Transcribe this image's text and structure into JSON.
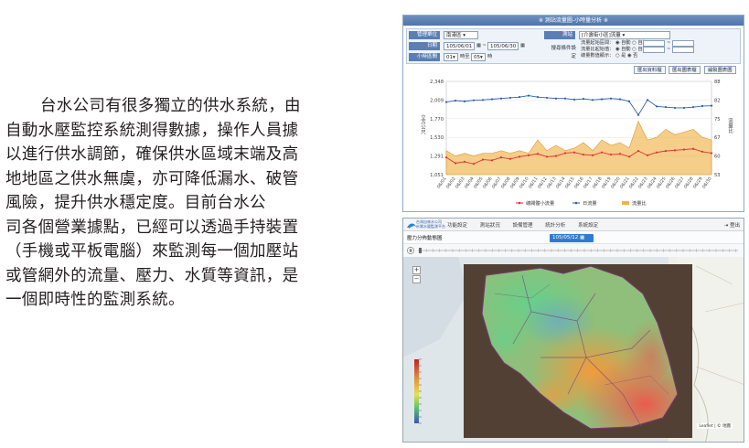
{
  "paragraph": {
    "lines": [
      "台水公司有很多獨立的供水系統，由",
      "自動水壓監控系統測得數據，操作人員據",
      "以進行供水調節，確保供水區域末端及高",
      "地地區之供水無虞，亦可降低漏水、破管",
      "風險，提升供水穩定度。目前台水公",
      "司各個營業據點，已經可以透過手持裝置",
      "（手機或平板電腦）來監測每一個加壓站",
      "或管網外的流量、壓力、水質等資訊，是",
      "一個即時性的監測系統。"
    ]
  },
  "top_panel": {
    "title": "※ 測站流量圖-小時量分析 ※",
    "form": {
      "region_label": "管理單位",
      "region_value": "南港區",
      "date_label": "日期",
      "date_from": "105/06/01",
      "date_to": "105/06/30",
      "time_label": "小時區間",
      "time_from": "01",
      "time_to": "05",
      "time_unit": "時",
      "time_sep": "時至",
      "station_label": "測站",
      "station_value": "[介壽街小區]流量",
      "option_label": "搜尋條件設定",
      "option_rows": [
        "流量起始區間： ◉ 自動  ○ 自訂",
        "流量比起始值： ◉ 自動  ○ 自訂",
        "總量數值顯示： ○ 是  ◉ 否"
      ],
      "buttons": [
        "匯出資料檔",
        "匯出圖表檔",
        "繪製圖表圖"
      ]
    },
    "chart_data": {
      "type": "line",
      "categories": [
        "06/01",
        "06/02",
        "06/03",
        "06/04",
        "06/05",
        "06/06",
        "06/07",
        "06/08",
        "06/09",
        "06/10",
        "06/11",
        "06/12",
        "06/13",
        "06/14",
        "06/15",
        "06/16",
        "06/17",
        "06/18",
        "06/19",
        "06/20",
        "06/21",
        "06/22",
        "06/23",
        "06/24",
        "06/25",
        "06/26",
        "06/27",
        "06/28",
        "06/29",
        "06/30"
      ],
      "ylabel": "立方公尺",
      "y2label": "流量比",
      "y_ticks": [
        "2,348",
        "2,009",
        "1,770",
        "1,530",
        "1,291",
        "1,051"
      ],
      "y2_ticks": [
        "88",
        "82",
        "75",
        "67",
        "60",
        "53"
      ],
      "ylim": [
        1051,
        2348
      ],
      "y2lim": [
        53,
        88
      ],
      "series": [
        {
          "name": "總閥體小流量",
          "color": "#e0303b",
          "axis": "left",
          "values": [
            1291,
            1210,
            1230,
            1200,
            1260,
            1250,
            1290,
            1270,
            1300,
            1320,
            1340,
            1300,
            1310,
            1350,
            1360,
            1330,
            1320,
            1360,
            1330,
            1340,
            1300,
            1380,
            1320,
            1360,
            1380,
            1390,
            1400,
            1410,
            1370,
            1350
          ]
        },
        {
          "name": "日流量",
          "color": "#2d5fb0",
          "axis": "left",
          "values": [
            2060,
            2080,
            2070,
            2085,
            2090,
            2100,
            2110,
            2120,
            2130,
            2150,
            2130,
            2120,
            2110,
            2110,
            2095,
            2105,
            2090,
            2100,
            2110,
            2100,
            2070,
            1880,
            2090,
            2000,
            1990,
            1980,
            1980,
            1990,
            2005,
            2009
          ]
        },
        {
          "name": "流量比",
          "color": "#f0b34a",
          "axis": "right",
          "values": [
            62,
            60,
            61,
            60,
            61,
            61,
            62,
            61,
            62,
            61,
            66,
            62,
            64,
            62,
            63,
            65,
            62,
            66,
            64,
            65,
            63,
            73,
            66,
            67,
            70,
            68,
            69,
            70,
            67,
            66
          ]
        }
      ],
      "legend_position": "bottom",
      "grid": true
    }
  },
  "bottom_panel": {
    "logo_text_1": "台灣自來水公司",
    "logo_text_2": "水質水量監測平台",
    "menu": [
      "功能設定",
      "測站狀況",
      "設備管理",
      "統計分析",
      "系統設定"
    ],
    "logout": "登出",
    "subtitle": "壓力分佈動態圖",
    "date_value": "105/05/12",
    "attribution": "Leaflet | © 地圖",
    "zoom_in": "+",
    "zoom_out": "−"
  }
}
